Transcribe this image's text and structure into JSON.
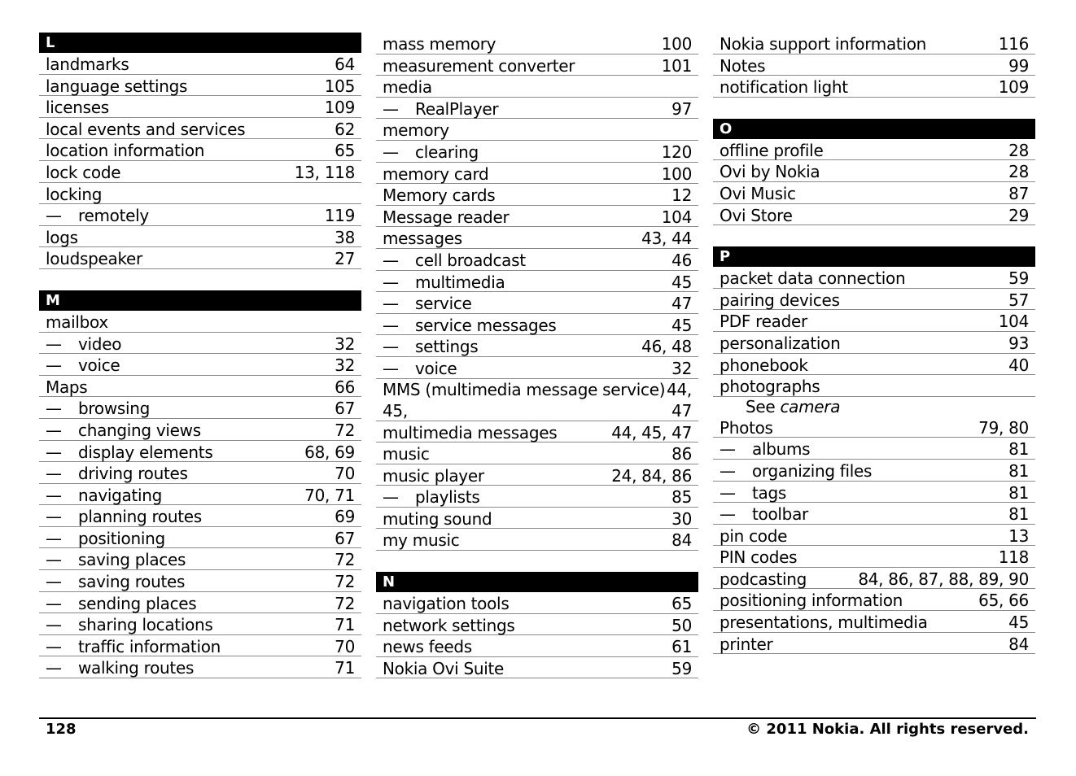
{
  "columns": [
    {
      "sections": [
        {
          "letter": "L",
          "entries": [
            {
              "term": "landmarks",
              "pages": "64"
            },
            {
              "term": "language settings",
              "pages": "105"
            },
            {
              "term": "licenses",
              "pages": "109"
            },
            {
              "term": "local events and services",
              "pages": "62"
            },
            {
              "term": "location information",
              "pages": "65"
            },
            {
              "term": "lock code",
              "pages": "13, 118"
            },
            {
              "term": "locking",
              "pages": ""
            },
            {
              "term": "remotely",
              "pages": "119",
              "sub": true
            },
            {
              "term": "logs",
              "pages": "38"
            },
            {
              "term": "loudspeaker",
              "pages": "27"
            }
          ]
        },
        {
          "letter": "M",
          "entries": [
            {
              "term": "mailbox",
              "pages": ""
            },
            {
              "term": "video",
              "pages": "32",
              "sub": true
            },
            {
              "term": "voice",
              "pages": "32",
              "sub": true
            },
            {
              "term": "Maps",
              "pages": "66"
            },
            {
              "term": "browsing",
              "pages": "67",
              "sub": true
            },
            {
              "term": "changing views",
              "pages": "72",
              "sub": true
            },
            {
              "term": "display elements",
              "pages": "68, 69",
              "sub": true
            },
            {
              "term": "driving routes",
              "pages": "70",
              "sub": true
            },
            {
              "term": "navigating",
              "pages": "70, 71",
              "sub": true
            },
            {
              "term": "planning routes",
              "pages": "69",
              "sub": true
            },
            {
              "term": "positioning",
              "pages": "67",
              "sub": true
            },
            {
              "term": "saving places",
              "pages": "72",
              "sub": true
            },
            {
              "term": "saving routes",
              "pages": "72",
              "sub": true
            },
            {
              "term": "sending places",
              "pages": "72",
              "sub": true
            },
            {
              "term": "sharing locations",
              "pages": "71",
              "sub": true
            },
            {
              "term": "traffic information",
              "pages": "70",
              "sub": true
            },
            {
              "term": "walking routes",
              "pages": "71",
              "sub": true
            }
          ]
        }
      ]
    },
    {
      "sections": [
        {
          "letter": "",
          "entries": [
            {
              "term": "mass memory",
              "pages": "100"
            },
            {
              "term": "measurement converter",
              "pages": "101"
            },
            {
              "term": "media",
              "pages": ""
            },
            {
              "term": "RealPlayer",
              "pages": "97",
              "sub": true
            },
            {
              "term": "memory",
              "pages": ""
            },
            {
              "term": "clearing",
              "pages": "120",
              "sub": true
            },
            {
              "term": "memory card",
              "pages": "100"
            },
            {
              "term": "Memory cards",
              "pages": "12"
            },
            {
              "term": "Message reader",
              "pages": "104"
            },
            {
              "term": "messages",
              "pages": "43, 44"
            },
            {
              "term": "cell broadcast",
              "pages": "46",
              "sub": true
            },
            {
              "term": "multimedia",
              "pages": "45",
              "sub": true
            },
            {
              "term": "service",
              "pages": "47",
              "sub": true
            },
            {
              "term": "service messages",
              "pages": "45",
              "sub": true
            },
            {
              "term": "settings",
              "pages": "46, 48",
              "sub": true
            },
            {
              "term": "voice",
              "pages": "32",
              "sub": true
            },
            {
              "term": "MMS (multimedia message service)",
              "pages": "44,",
              "wrap_term": "45,",
              "wrap_pages": "47"
            },
            {
              "term": "multimedia messages",
              "pages": "44, 45, 47"
            },
            {
              "term": "music",
              "pages": "86"
            },
            {
              "term": "music player",
              "pages": "24, 84, 86"
            },
            {
              "term": "playlists",
              "pages": "85",
              "sub": true
            },
            {
              "term": "muting sound",
              "pages": "30"
            },
            {
              "term": "my music",
              "pages": "84"
            }
          ]
        },
        {
          "letter": "N",
          "entries": [
            {
              "term": "navigation tools",
              "pages": "65"
            },
            {
              "term": "network settings",
              "pages": "50"
            },
            {
              "term": "news feeds",
              "pages": "61"
            },
            {
              "term": "Nokia Ovi Suite",
              "pages": "59"
            }
          ]
        }
      ]
    },
    {
      "sections": [
        {
          "letter": "",
          "entries": [
            {
              "term": "Nokia support information",
              "pages": "116"
            },
            {
              "term": "Notes",
              "pages": "99"
            },
            {
              "term": "notification light",
              "pages": "109"
            }
          ]
        },
        {
          "letter": "O",
          "entries": [
            {
              "term": "offline profile",
              "pages": "28"
            },
            {
              "term": "Ovi by Nokia",
              "pages": "28"
            },
            {
              "term": "Ovi Music",
              "pages": "87"
            },
            {
              "term": "Ovi Store",
              "pages": "29"
            }
          ]
        },
        {
          "letter": "P",
          "entries": [
            {
              "term": "packet data connection",
              "pages": "59"
            },
            {
              "term": "pairing devices",
              "pages": "57"
            },
            {
              "term": "PDF reader",
              "pages": "104"
            },
            {
              "term": "personalization",
              "pages": "93"
            },
            {
              "term": "phonebook",
              "pages": "40"
            },
            {
              "term": "photographs",
              "pages": ""
            },
            {
              "term": "",
              "pages": "",
              "see": "See",
              "see_ref": "camera"
            },
            {
              "term": "Photos",
              "pages": "79, 80"
            },
            {
              "term": "albums",
              "pages": "81",
              "sub": true
            },
            {
              "term": "organizing files",
              "pages": "81",
              "sub": true
            },
            {
              "term": "tags",
              "pages": "81",
              "sub": true
            },
            {
              "term": "toolbar",
              "pages": "81",
              "sub": true
            },
            {
              "term": "pin code",
              "pages": "13"
            },
            {
              "term": "PIN codes",
              "pages": "118"
            },
            {
              "term": "podcasting",
              "pages": "84, 86, 87, 88, 89, 90"
            },
            {
              "term": "positioning information",
              "pages": "65, 66"
            },
            {
              "term": "presentations, multimedia",
              "pages": "45"
            },
            {
              "term": "printer",
              "pages": "84"
            }
          ]
        }
      ]
    }
  ],
  "sub_dash": "—",
  "footer": {
    "page_number": "128",
    "copyright": "© 2011 Nokia. All rights reserved."
  }
}
